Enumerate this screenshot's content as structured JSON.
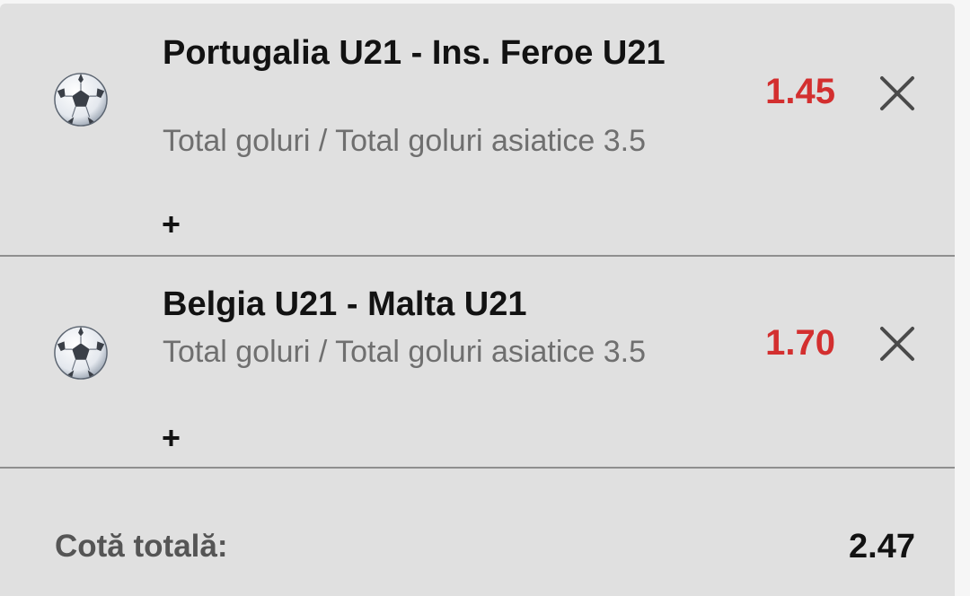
{
  "bets": [
    {
      "match": "Portugalia U21 - Ins. Feroe U21",
      "market": "Total goluri / Total goluri asiatice 3.5",
      "odds": "1.45",
      "sport_icon": "soccer-ball-icon",
      "expand_icon": "plus-icon",
      "remove_icon": "close-icon"
    },
    {
      "match": "Belgia U21 - Malta U21",
      "market": "Total goluri / Total goluri asiatice 3.5",
      "odds": "1.70",
      "sport_icon": "soccer-ball-icon",
      "expand_icon": "plus-icon",
      "remove_icon": "close-icon"
    }
  ],
  "total": {
    "label": "Cotă totală:",
    "value": "2.47"
  },
  "colors": {
    "panel_background": "#e0e0e0",
    "odds": "#d32f2f",
    "title_text": "#121212",
    "secondary_text": "#6f6f6f",
    "separator": "#8f8f8f"
  }
}
